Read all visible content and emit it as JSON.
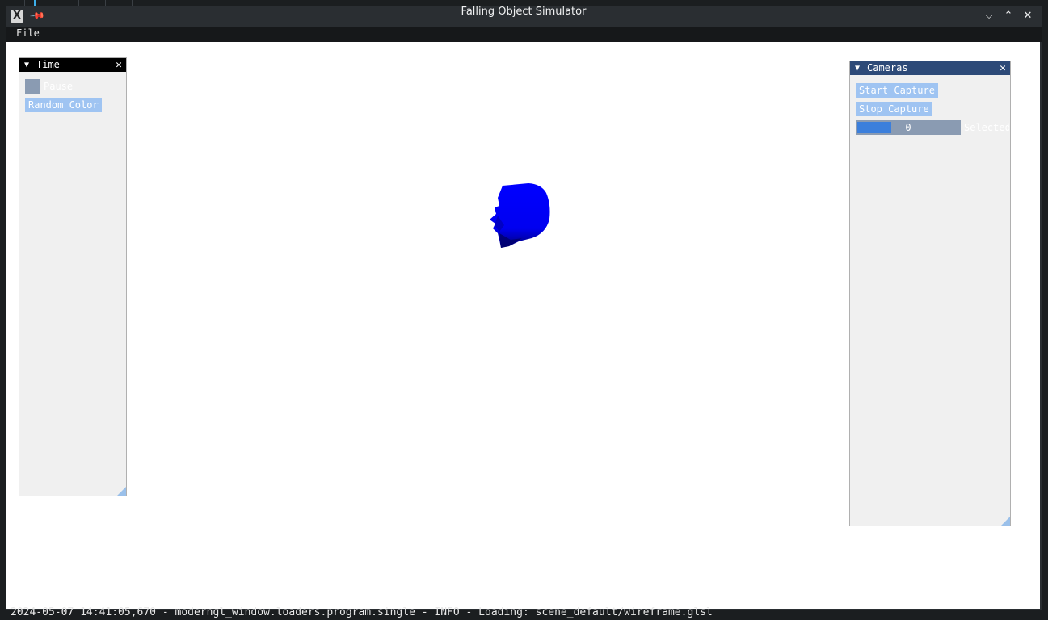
{
  "window": {
    "title": "Falling Object Simulator",
    "app_icon_glyph": "X",
    "icons": [
      "app-icon",
      "pin-icon",
      "minimize-icon",
      "maximize-icon",
      "close-icon"
    ]
  },
  "menubar": {
    "file_label": "File"
  },
  "time_panel": {
    "title": "Time",
    "pause_label": "Pause",
    "pause_checked": false,
    "random_color_label": "Random Color",
    "header_color": "#000000"
  },
  "cameras_panel": {
    "title": "Cameras",
    "start_capture_label": "Start Capture",
    "stop_capture_label": "Stop Capture",
    "slider_value": "0",
    "slider_label": "Selected",
    "header_color": "#2d4a78"
  },
  "scene": {
    "object_color": "#0000ff"
  },
  "console": {
    "log_line": "2024-05-07 14:41:05,670 - moderngl_window.loaders.program.single - INFO - Loading: scene_default/wireframe.glsl"
  },
  "colors": {
    "accent": "#3daee9",
    "button": "#9fc4f2",
    "slider_fill": "#3b7fdc"
  }
}
